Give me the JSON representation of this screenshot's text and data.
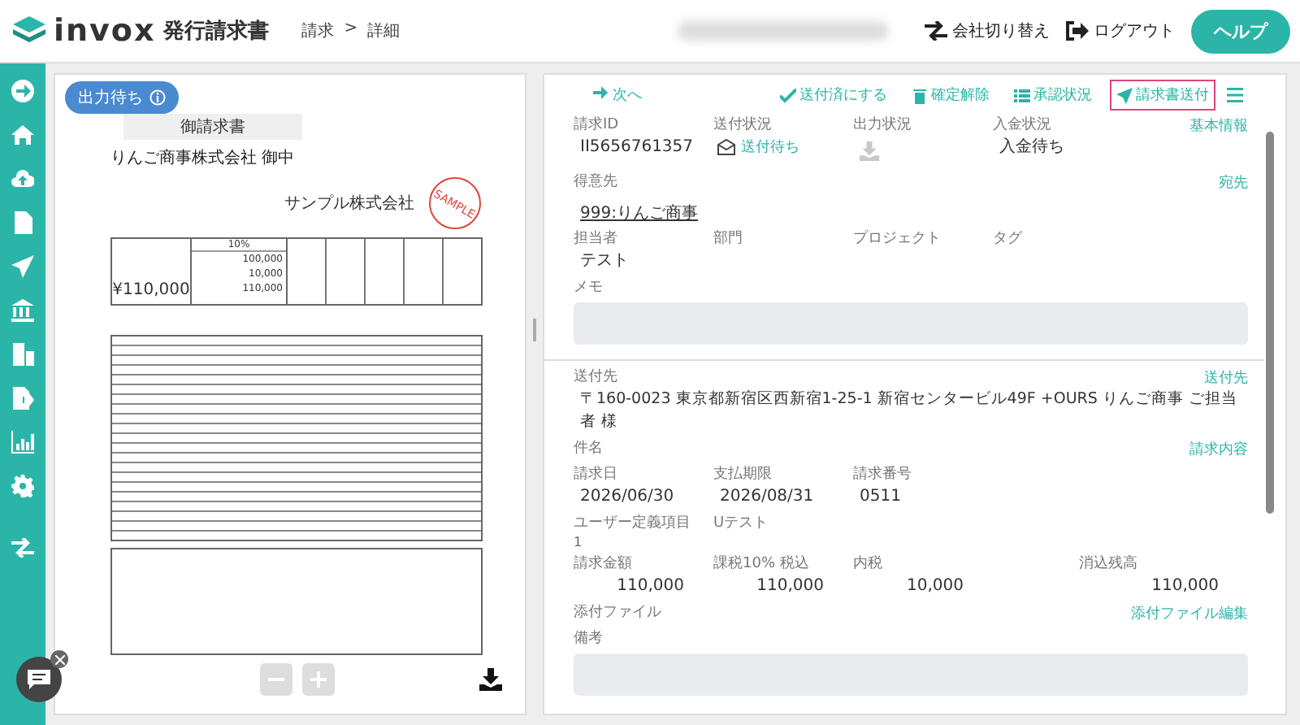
{
  "header": {
    "logo": "invox",
    "product": "発行請求書",
    "breadcrumb": [
      "請求",
      "詳細"
    ],
    "breadcrumb_separator": ">",
    "actions": [
      {
        "label": "会社切り替え",
        "kind": "switch"
      },
      {
        "label": "ログアウト",
        "kind": "logout"
      }
    ],
    "help": "ヘルプ"
  },
  "preview": {
    "status_badge": "出力待ち",
    "document": {
      "title": "御請求書",
      "recipient": "りんご商事株式会社 御中",
      "issuer": "サンプル株式会社",
      "tax_rate": "10%",
      "amounts": [
        "100,000",
        "10,000",
        "110,000"
      ],
      "total": "¥110,000",
      "stamp": "SAMPLE"
    }
  },
  "detail": {
    "next": "次へ",
    "toolbar": [
      {
        "label": "送付済にする",
        "kind": "check",
        "highlighted": false
      },
      {
        "label": "確定解除",
        "kind": "trash",
        "highlighted": false
      },
      {
        "label": "承認状況",
        "kind": "list",
        "highlighted": false
      },
      {
        "label": "請求書送付",
        "kind": "send",
        "highlighted": true
      }
    ],
    "sections": [
      {
        "link": "基本情報",
        "divider": false,
        "rows": [
          [
            {
              "label": "請求ID",
              "value": "II5656761357",
              "kind": "text"
            },
            {
              "label": "送付状況",
              "value": "送付待ち",
              "kind": "status"
            },
            {
              "label": "出力状況",
              "kind": "download"
            },
            {
              "label": "入金状況",
              "value": "入金待ち",
              "kind": "text"
            }
          ]
        ]
      },
      {
        "link": "宛先",
        "divider": false,
        "rows": [
          [
            {
              "label": "得意先",
              "value": "999:りんご商事",
              "kind": "underline"
            }
          ],
          [
            {
              "label": "担当者",
              "value": "テスト",
              "kind": "text"
            },
            {
              "label": "部門",
              "kind": "empty"
            },
            {
              "label": "プロジェクト",
              "kind": "empty"
            },
            {
              "label": "タグ",
              "kind": "empty"
            }
          ],
          [
            {
              "label": "メモ",
              "kind": "textarea"
            }
          ]
        ]
      },
      {
        "link": "送付先",
        "divider": true,
        "rows": [
          [
            {
              "label": "送付先",
              "value": "〒160-0023 東京都新宿区西新宿1-25-1 新宿センタービル49F +OURS りんご商事 ご担当者 様",
              "kind": "wide"
            }
          ]
        ]
      },
      {
        "link": "請求内容",
        "divider": false,
        "rows": [
          [
            {
              "label": "件名",
              "kind": "empty"
            }
          ],
          [
            {
              "label": "請求日",
              "value": "2026/06/30",
              "kind": "text"
            },
            {
              "label": "支払期限",
              "value": "2026/08/31",
              "kind": "text"
            },
            {
              "label": "請求番号",
              "value": "0511",
              "kind": "text"
            }
          ],
          [
            {
              "label": "ユーザー定義項目",
              "value": "1",
              "kind": "small"
            },
            {
              "label": "Uテスト",
              "kind": "empty"
            }
          ],
          [
            {
              "label": "請求金額",
              "value": "110,000",
              "kind": "amount"
            },
            {
              "label": "課税10% 税込",
              "value": "110,000",
              "kind": "amount"
            },
            {
              "label": "内税",
              "value": "10,000",
              "kind": "amount"
            },
            {
              "label": "消込残高",
              "value": "110,000",
              "kind": "balance"
            }
          ]
        ]
      },
      {
        "link": "添付ファイル編集",
        "divider": false,
        "rows": [
          [
            {
              "label": "添付ファイル",
              "kind": "empty"
            }
          ],
          [
            {
              "label": "備考",
              "kind": "textarea"
            }
          ]
        ]
      }
    ]
  }
}
